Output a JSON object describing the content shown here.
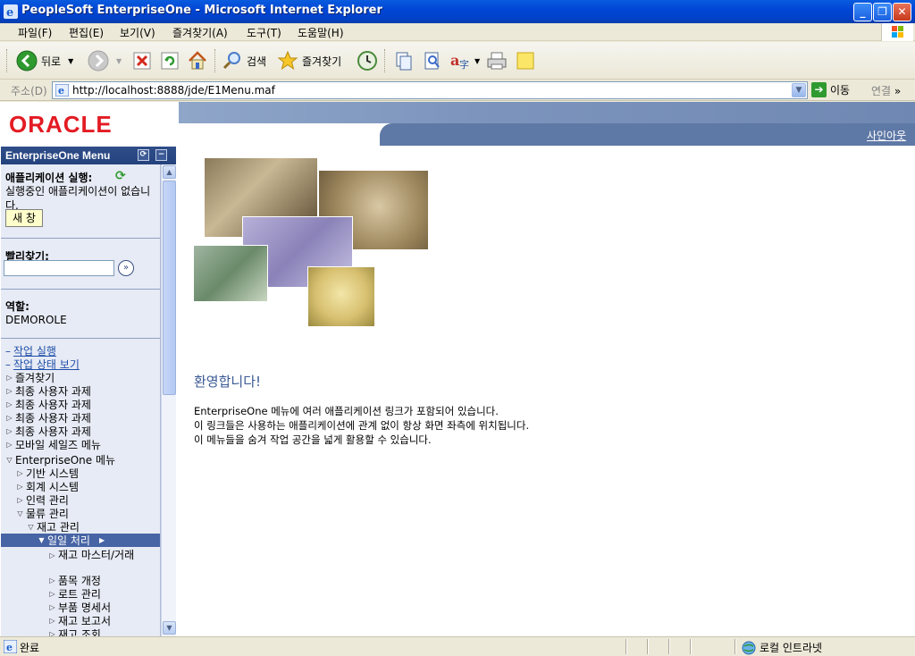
{
  "window": {
    "title": "PeopleSoft EnterpriseOne - Microsoft Internet Explorer"
  },
  "menubar": {
    "items": [
      "파일(F)",
      "편집(E)",
      "보기(V)",
      "즐겨찾기(A)",
      "도구(T)",
      "도움말(H)"
    ]
  },
  "toolbar": {
    "back_label": "뒤로",
    "search_label": "검색",
    "favorites_label": "즐겨찾기"
  },
  "address": {
    "label": "주소(D)",
    "url": "http://localhost:8888/jde/E1Menu.maf",
    "go_label": "이동",
    "links_label": "연결"
  },
  "banner": {
    "logo": "ORACLE",
    "signout": "사인아웃"
  },
  "leftpanel": {
    "header": "EnterpriseOne Menu",
    "apps": {
      "title": "애플리케이션 실행:",
      "text": "실행중인 애플리케이션이 없습니다.",
      "newwin": "새 창"
    },
    "quick": {
      "title": "빨리찾기:",
      "value": ""
    },
    "role": {
      "title": "역할:",
      "value": "DEMOROLE"
    },
    "tree": [
      "작업 실행",
      "작업 상태 보기",
      "즐겨찾기",
      "최종 사용자 과제",
      "최종 사용자 과제",
      "최종 사용자 과제",
      "최종 사용자 과제",
      "모바일 세일즈 메뉴",
      "EnterpriseOne 메뉴",
      "기반 시스템",
      "회계 시스템",
      "인력 관리",
      "물류 관리",
      "재고 관리",
      "일일 처리",
      "재고 마스터/거래",
      "품목 개정",
      "로트 관리",
      "부품 명세서",
      "재고 보고서",
      "재고 조회"
    ]
  },
  "main": {
    "welcome": "환영합니다!",
    "lines": [
      "EnterpriseOne 메뉴에 여러 애플리케이션 링크가 포함되어 있습니다.",
      "이 링크들은 사용하는 애플리케이션에 관계 없이 항상 화면 좌측에 위치됩니다.",
      "이 메뉴들을 숨겨 작업 공간을 넓게 활용할 수 있습니다."
    ]
  },
  "status": {
    "text": "완료",
    "zone": "로컬 인트라넷"
  }
}
